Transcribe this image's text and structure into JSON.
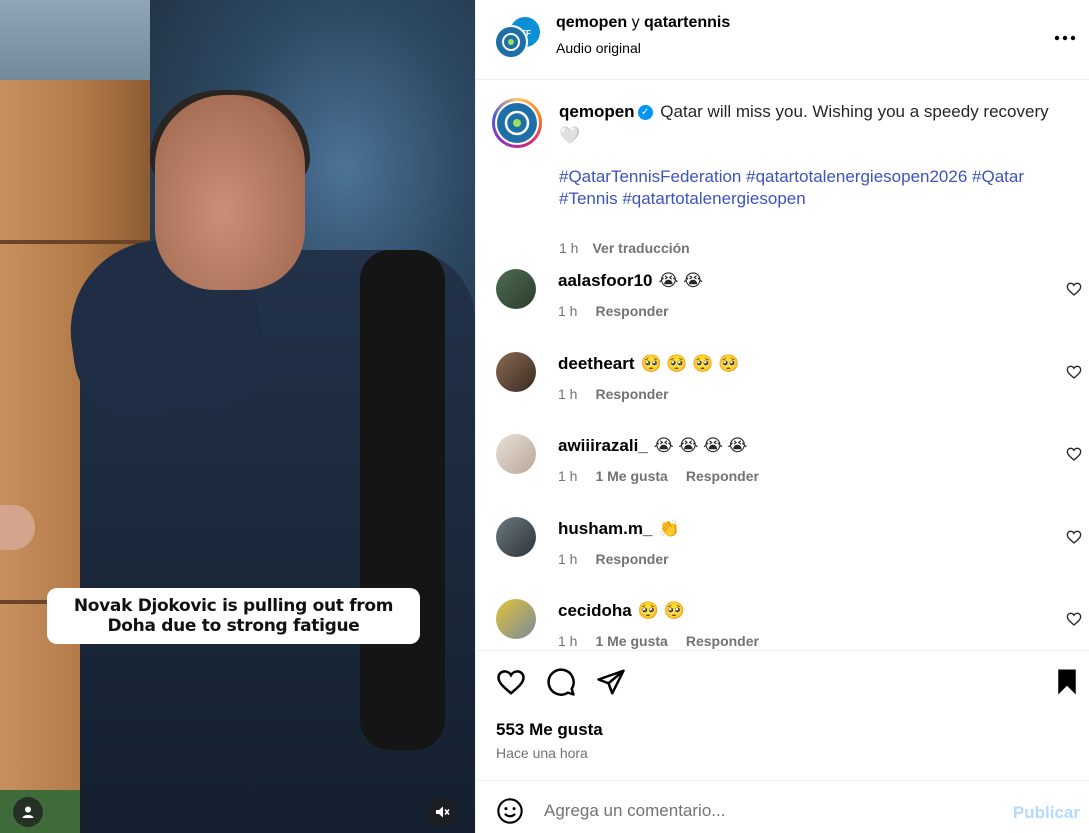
{
  "media": {
    "caption": "Novak Djokovic is pulling out from Doha due to strong fatigue"
  },
  "header": {
    "user1": "qemopen",
    "connector": " y ",
    "user2": "qatartennis",
    "audio": "Audio original",
    "more_icon": "more-horizontal-icon"
  },
  "caption": {
    "user": "qemopen",
    "text": "Qatar will miss you. Wishing you a speedy recovery 🤍",
    "tags": "#QatarTennisFederation #qatartotalenergiesopen2026 #Qatar #Tennis #qatartotalenergiesopen",
    "time": "1 h",
    "translate": "Ver traducción"
  },
  "comments": [
    {
      "user": "aalasfoor10",
      "text": "😭 😭",
      "time": "1 h",
      "likes": "",
      "reply": "Responder"
    },
    {
      "user": "deetheart",
      "text": "🥺 🥺 🥺 🥺",
      "time": "1 h",
      "likes": "",
      "reply": "Responder"
    },
    {
      "user": "awiiirazali_",
      "text": "😭 😭 😭 😭",
      "time": "1 h",
      "likes": "1 Me gusta",
      "reply": "Responder"
    },
    {
      "user": "husham.m_",
      "text": "👏",
      "time": "1 h",
      "likes": "",
      "reply": "Responder"
    },
    {
      "user": "cecidoha",
      "text": "🥺 🥺",
      "time": "1 h",
      "likes": "1 Me gusta",
      "reply": "Responder"
    }
  ],
  "actions": {
    "likes": "553 Me gusta",
    "when": "Hace una hora"
  },
  "add_comment": {
    "placeholder": "Agrega un comentario...",
    "publish": "Publicar"
  },
  "colors": {
    "link_blue": "#3c54bd",
    "verified_blue": "#0095f6",
    "publish_disabled": "#b3dbff",
    "meta_gray": "#737373"
  }
}
